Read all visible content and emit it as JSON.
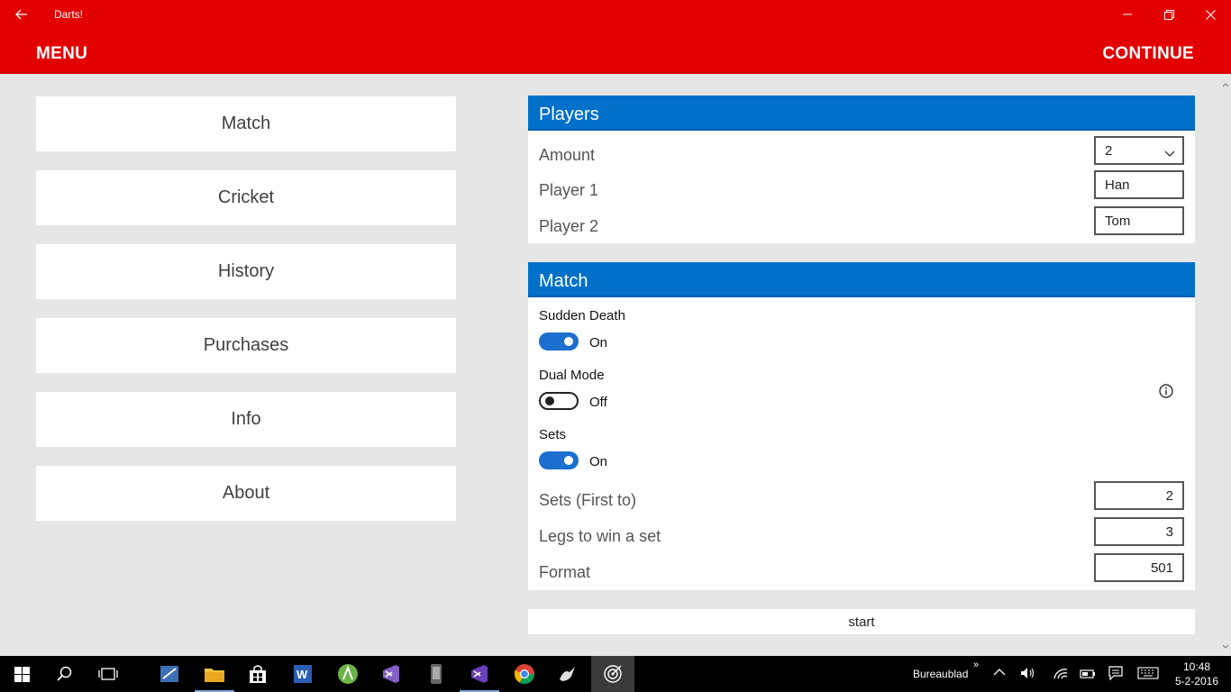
{
  "window": {
    "title": "Darts!"
  },
  "appbar": {
    "menu_label": "MENU",
    "continue_label": "CONTINUE"
  },
  "nav": {
    "items": [
      "Match",
      "Cricket",
      "History",
      "Purchases",
      "Info",
      "About"
    ]
  },
  "players_panel": {
    "header": "Players",
    "amount_label": "Amount",
    "amount_value": "2",
    "player1_label": "Player 1",
    "player1_value": "Han",
    "player2_label": "Player 2",
    "player2_value": "Tom"
  },
  "match_panel": {
    "header": "Match",
    "sudden_death_label": "Sudden Death",
    "sudden_death_state": "On",
    "dual_mode_label": "Dual Mode",
    "dual_mode_state": "Off",
    "sets_label": "Sets",
    "sets_state": "On",
    "sets_first_to_label": "Sets (First to)",
    "sets_first_to_value": "2",
    "legs_label": "Legs to win a set",
    "legs_value": "3",
    "format_label": "Format",
    "format_value": "501"
  },
  "start_label": "start",
  "taskbar": {
    "desktop_label": "Bureaublad",
    "time": "10:48",
    "date": "5-2-2016"
  },
  "colors": {
    "brand_red": "#e30000",
    "header_blue": "#0070c9",
    "toggle_on": "#1a6fcf"
  }
}
